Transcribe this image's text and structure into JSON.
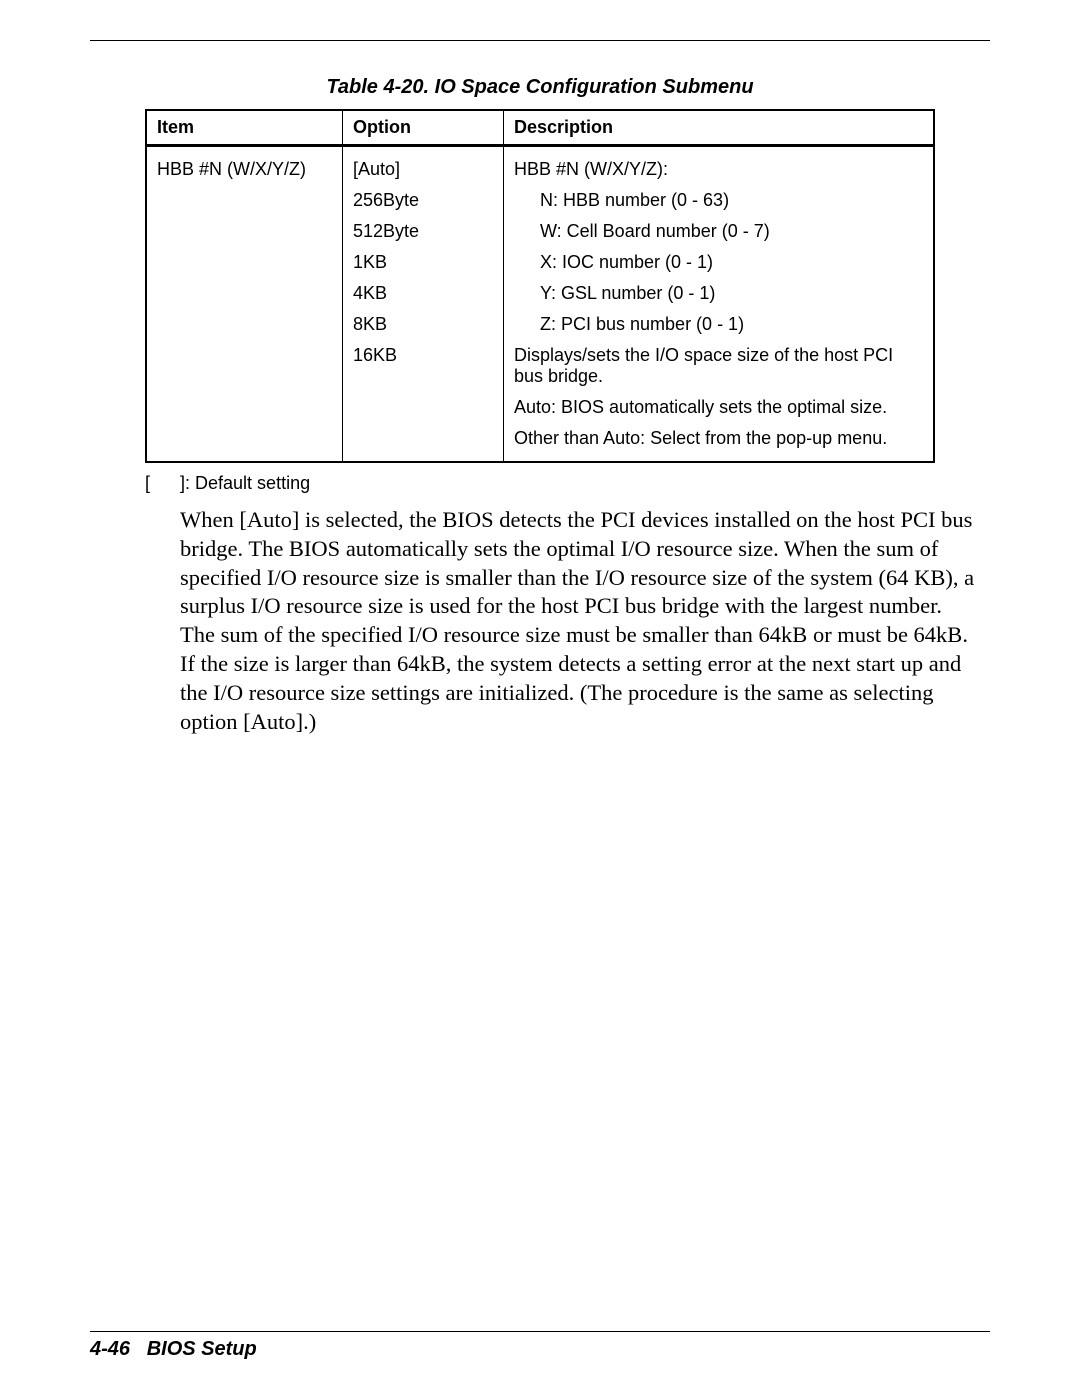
{
  "caption": "Table 4-20.  IO Space Configuration Submenu",
  "headers": {
    "item": "Item",
    "option": "Option",
    "description": "Description"
  },
  "row": {
    "item": "HBB #N (W/X/Y/Z)",
    "options": [
      "[Auto]",
      "256Byte",
      "512Byte",
      "1KB",
      "4KB",
      "8KB",
      "16KB"
    ],
    "desc_head": "HBB #N (W/X/Y/Z):",
    "desc_lines": [
      "N: HBB number (0 - 63)",
      "W: Cell Board number (0 - 7)",
      "X: IOC number (0 - 1)",
      "Y: GSL number (0 - 1)",
      "Z: PCI bus number (0 - 1)"
    ],
    "desc_tail": [
      "Displays/sets the I/O space size of the host PCI bus bridge.",
      "Auto: BIOS automatically sets the optimal size.",
      "Other than Auto: Select from the pop-up menu."
    ]
  },
  "default_note_prefix": "[",
  "default_note_suffix": "]: Default setting",
  "body": "When [Auto] is selected, the BIOS detects the PCI devices installed on the host PCI bus bridge. The BIOS automatically sets the optimal I/O resource size.  When the sum of specified I/O resource size is smaller than the I/O resource size of the system (64 KB), a surplus I/O resource size is used for the host PCI bus bridge with the largest number. The sum of the specified I/O resource size must be smaller than 64kB or must be 64kB.  If the size is larger than 64kB, the system detects a setting error at the next start up and the I/O resource size settings are initialized.  (The procedure is the same as selecting option [Auto].)",
  "footer": {
    "page": "4-46",
    "section": "BIOS Setup"
  }
}
